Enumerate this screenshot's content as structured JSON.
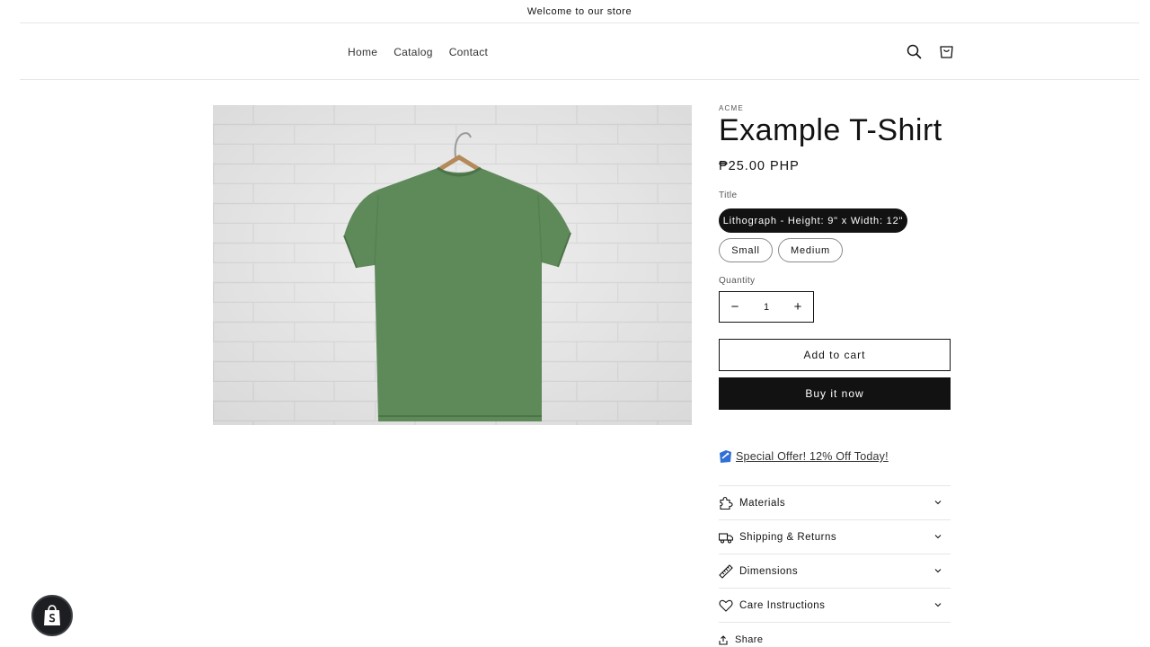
{
  "announcement": {
    "text": "Welcome to our store"
  },
  "nav": {
    "items": [
      {
        "label": "Home"
      },
      {
        "label": "Catalog"
      },
      {
        "label": "Contact"
      }
    ]
  },
  "header_icons": {
    "search": "search-icon",
    "cart": "cart-icon"
  },
  "product": {
    "vendor": "ACME",
    "title": "Example T-Shirt",
    "price": "₱25.00 PHP",
    "option_label": "Title",
    "options": [
      {
        "label": "Lithograph - Height: 9\" x Width: 12\"",
        "selected": true
      },
      {
        "label": "Small",
        "selected": false
      },
      {
        "label": "Medium",
        "selected": false
      }
    ],
    "quantity_label": "Quantity",
    "quantity_value": "1",
    "decrease_symbol": "−",
    "increase_symbol": "+",
    "add_to_cart": "Add to cart",
    "buy_now": "Buy it now",
    "offer_text": "Special Offer! 12% Off Today!",
    "accordion": [
      {
        "label": "Materials",
        "icon": "puzzle-icon"
      },
      {
        "label": "Shipping & Returns",
        "icon": "truck-icon"
      },
      {
        "label": "Dimensions",
        "icon": "ruler-icon"
      },
      {
        "label": "Care Instructions",
        "icon": "heart-icon"
      }
    ],
    "share": "Share",
    "image": {
      "description_icon": "green-tshirt-on-hanger"
    }
  },
  "colors": {
    "text": "#121212",
    "button_dark": "#121212",
    "shirt": "#5e8a5a",
    "wall": "#e9e9e9"
  }
}
